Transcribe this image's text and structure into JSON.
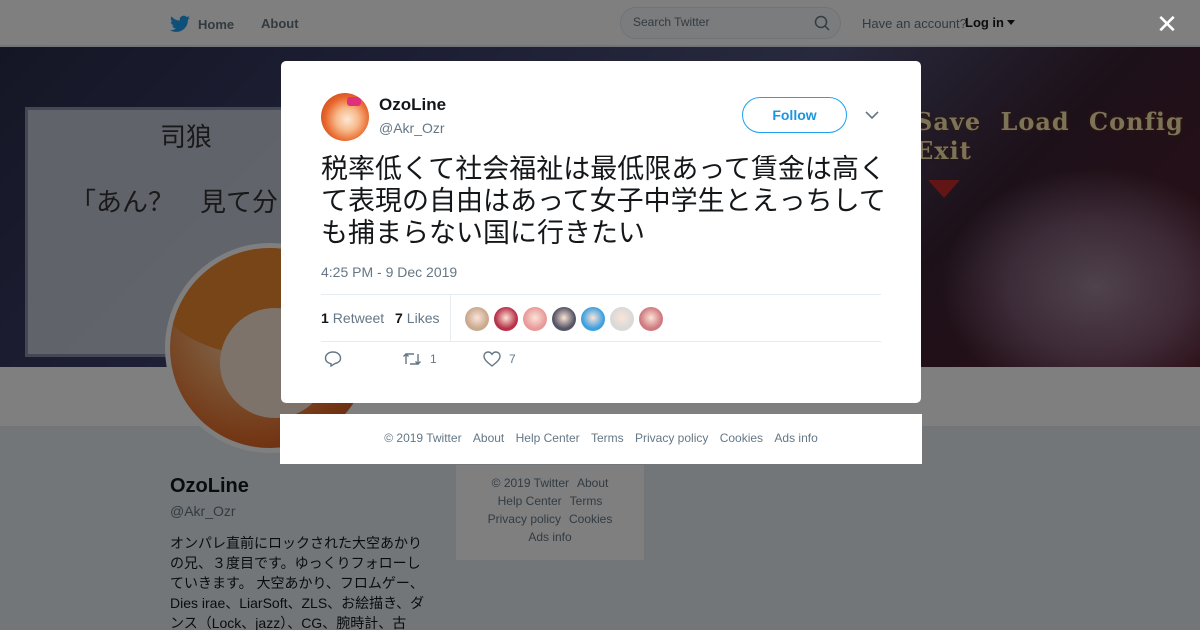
{
  "nav": {
    "home_label": "Home",
    "about_label": "About",
    "search_placeholder": "Search Twitter",
    "account_question": "Have an account?",
    "login_label": "Log in"
  },
  "banner": {
    "text1": "司狼",
    "text2": "「あん？　見て分",
    "menu": "Save Load Config Exit"
  },
  "profile": {
    "name": "OzoLine",
    "handle": "@Akr_Ozr",
    "bio": "オンパレ直前にロックされた大空あかりの兄、３度目です。ゆっくりフォローしていきます。 大空あかり、フロムゲー、Dies irae、LiarSoft、ZLS、お絵描き、ダンス（Lock、jazz）、CG、腕時計、古"
  },
  "side_footer": [
    "© 2019 Twitter",
    "About",
    "Help Center",
    "Terms",
    "Privacy policy",
    "Cookies",
    "Ads info"
  ],
  "tweet": {
    "name": "OzoLine",
    "handle": "@Akr_Ozr",
    "follow_label": "Follow",
    "text": "税率低くて社会福祉は最低限あって賃金は高くて表現の自由はあって女子中学生とえっちしても捕まらない国に行きたい",
    "time": "4:25 PM - 9 Dec 2019",
    "retweet_count": "1",
    "retweet_label": "Retweet",
    "like_count": "7",
    "like_label": "Likes",
    "action_retweet_count": "1",
    "action_like_count": "7"
  },
  "likers_colors": [
    "#c9a98f",
    "#b8314a",
    "#e89a9a",
    "#555566",
    "#3fa0e0",
    "#d9d9d9",
    "#d07a80"
  ],
  "footer": {
    "copyright": "© 2019 Twitter",
    "about": "About",
    "help": "Help Center",
    "terms": "Terms",
    "privacy": "Privacy policy",
    "cookies": "Cookies",
    "ads": "Ads info"
  },
  "colors": {
    "twitter_blue": "#1da1f2",
    "overlay": "rgba(0,0,0,0.5)"
  }
}
